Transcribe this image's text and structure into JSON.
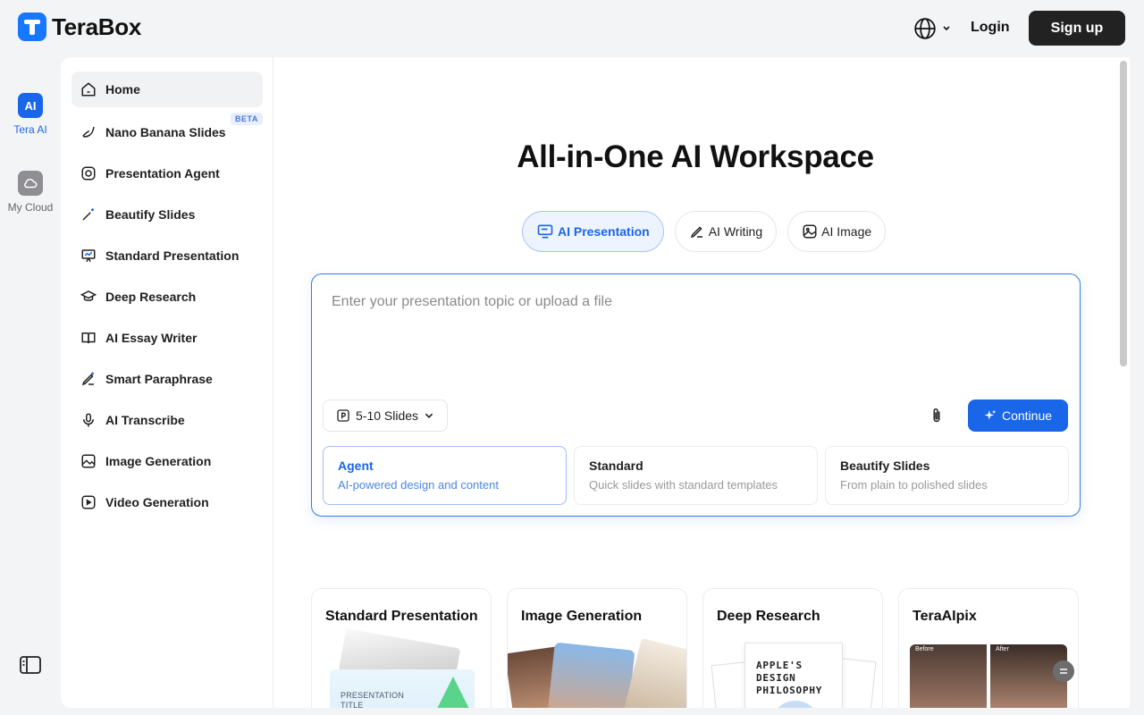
{
  "header": {
    "brand": "TeraBox",
    "login_label": "Login",
    "signup_label": "Sign up"
  },
  "rail": {
    "items": [
      {
        "label": "Tera AI",
        "icon_text": "AI",
        "icon": "ai-icon",
        "active": true
      },
      {
        "label": "My Cloud",
        "icon": "cloud-icon",
        "active": false
      }
    ]
  },
  "sidebar": {
    "items": [
      {
        "label": "Home",
        "icon": "home-icon"
      },
      {
        "label": "Nano Banana Slides",
        "icon": "banana-icon",
        "badge": "BETA"
      },
      {
        "label": "Presentation Agent",
        "icon": "agent-icon"
      },
      {
        "label": "Beautify Slides",
        "icon": "magic-wand-icon"
      },
      {
        "label": "Standard Presentation",
        "icon": "presentation-icon"
      },
      {
        "label": "Deep Research",
        "icon": "graduation-cap-icon"
      },
      {
        "label": "AI Essay Writer",
        "icon": "book-icon"
      },
      {
        "label": "Smart Paraphrase",
        "icon": "pen-sparkle-icon"
      },
      {
        "label": "AI Transcribe",
        "icon": "microphone-icon"
      },
      {
        "label": "Image Generation",
        "icon": "image-icon"
      },
      {
        "label": "Video Generation",
        "icon": "video-icon"
      }
    ]
  },
  "main": {
    "title": "All-in-One AI Workspace",
    "tabs": [
      {
        "label": "AI Presentation",
        "icon": "presentation-chat-icon",
        "active": true
      },
      {
        "label": "AI Writing",
        "icon": "pen-icon",
        "active": false
      },
      {
        "label": "AI Image",
        "icon": "image-sparkle-icon",
        "active": false
      }
    ],
    "composer": {
      "placeholder": "Enter your presentation topic or upload a file",
      "value": "",
      "slides_label": "5-10 Slides",
      "continue_label": "Continue",
      "modes": [
        {
          "title": "Agent",
          "desc": "AI-powered design and content",
          "active": true
        },
        {
          "title": "Standard",
          "desc": "Quick slides with standard templates",
          "active": false
        },
        {
          "title": "Beautify Slides",
          "desc": "From plain to polished slides",
          "active": false
        }
      ]
    },
    "feature_cards": [
      {
        "title": "Standard Presentation",
        "thumb_text": "PRESENTATION TITLE"
      },
      {
        "title": "Image Generation"
      },
      {
        "title": "Deep Research",
        "thumb_text": "APPLE'S DESIGN PHILOSOPHY"
      },
      {
        "title": "TeraAIpix",
        "before": "Before",
        "after": "After"
      }
    ]
  },
  "colors": {
    "accent": "#1a66e8",
    "signup_bg": "#222222",
    "page_bg": "#f3f4f6"
  }
}
